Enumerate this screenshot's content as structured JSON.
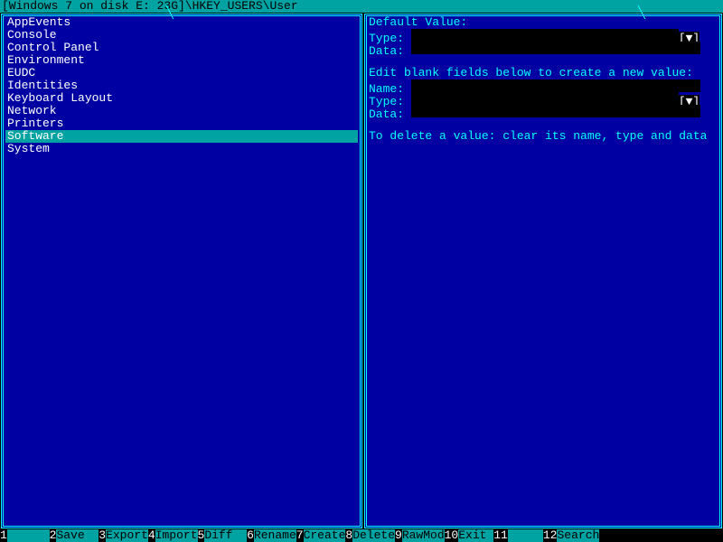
{
  "title": "[Windows 7 on disk E: 23G]\\HKEY_USERS\\User",
  "tree": {
    "items": [
      {
        "label": "AppEvents",
        "selected": false
      },
      {
        "label": "Console",
        "selected": false
      },
      {
        "label": "Control Panel",
        "selected": false
      },
      {
        "label": "Environment",
        "selected": false
      },
      {
        "label": "EUDC",
        "selected": false
      },
      {
        "label": "Identities",
        "selected": false
      },
      {
        "label": "Keyboard Layout",
        "selected": false
      },
      {
        "label": "Network",
        "selected": false
      },
      {
        "label": "Printers",
        "selected": false
      },
      {
        "label": "Software",
        "selected": true
      },
      {
        "label": "System",
        "selected": false
      }
    ]
  },
  "right": {
    "default_header": "Default Value:",
    "type_label": "Type:",
    "data_label": "Data:",
    "name_label": "Name:",
    "dropdown_marker": "[▼]",
    "edit_hint": "Edit blank fields below to create a new value:",
    "delete_hint": "To delete a value: clear its name, type and data",
    "default_type": "",
    "default_data": "",
    "new_name": "",
    "new_type": "",
    "new_data": ""
  },
  "fkeys": [
    {
      "num": "1",
      "label": "      "
    },
    {
      "num": "2",
      "label": "Save  "
    },
    {
      "num": "3",
      "label": "Export"
    },
    {
      "num": "4",
      "label": "Import"
    },
    {
      "num": "5",
      "label": "Diff  "
    },
    {
      "num": "6",
      "label": "Rename"
    },
    {
      "num": "7",
      "label": "Create"
    },
    {
      "num": "8",
      "label": "Delete"
    },
    {
      "num": "9",
      "label": "RawMod"
    },
    {
      "num": "10",
      "label": "Exit "
    },
    {
      "num": "11",
      "label": "     "
    },
    {
      "num": "12",
      "label": "Search"
    }
  ]
}
